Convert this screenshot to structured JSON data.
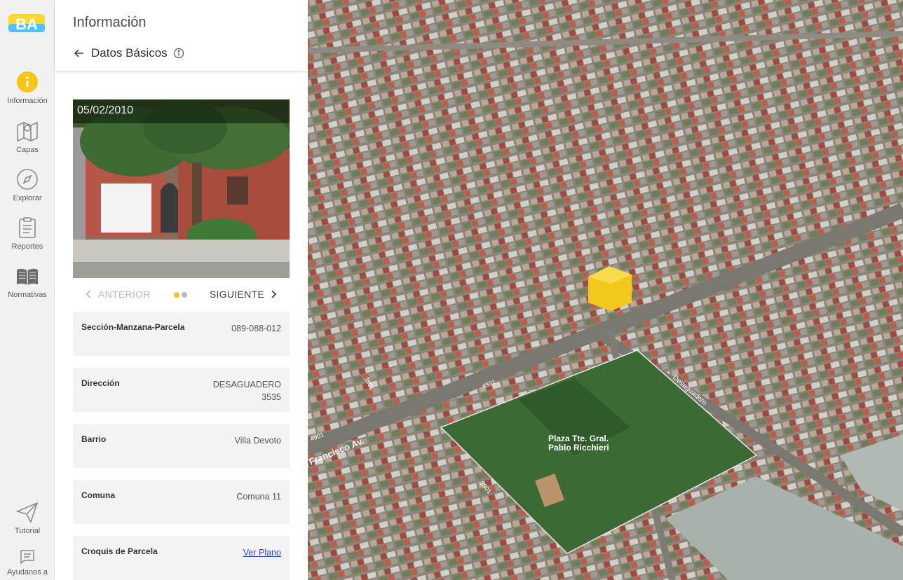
{
  "nav": {
    "logo_text": "BA",
    "items": [
      {
        "label": "Información",
        "icon": "info-icon"
      },
      {
        "label": "Capas",
        "icon": "map-layers-icon"
      },
      {
        "label": "Explorar",
        "icon": "compass-icon"
      },
      {
        "label": "Reportes",
        "icon": "clipboard-icon"
      },
      {
        "label": "Normativas",
        "icon": "book-icon"
      },
      {
        "label": "Tutorial",
        "icon": "paper-plane-icon"
      },
      {
        "label": "Ayudanos a",
        "icon": "chat-icon"
      }
    ]
  },
  "panel": {
    "title": "Información",
    "subtitle": "Datos Básicos",
    "photo_date": "05/02/2010",
    "prev_label": "ANTERIOR",
    "next_label": "SIGUIENTE",
    "fields": [
      {
        "key": "Sección-Manzana-Parcela",
        "value": "089-088-012"
      },
      {
        "key": "Dirección",
        "value_line1": "DESAGUADERO",
        "value_line2": "3535"
      },
      {
        "key": "Barrio",
        "value": "Villa Devoto"
      },
      {
        "key": "Comuna",
        "value": "Comuna 11"
      },
      {
        "key": "Croquis de Parcela",
        "link": "Ver Plano"
      }
    ]
  },
  "map": {
    "labels": [
      "Francisco Av.",
      "Plaza Tte. Gral.",
      "Pablo Ricchieri",
      "Desaguadero",
      "4801",
      "3301",
      "3501",
      "4901"
    ]
  },
  "colors": {
    "accent_yellow": "#f5c518",
    "dot_inactive": "#b9b9b9",
    "link": "#3347c8"
  }
}
